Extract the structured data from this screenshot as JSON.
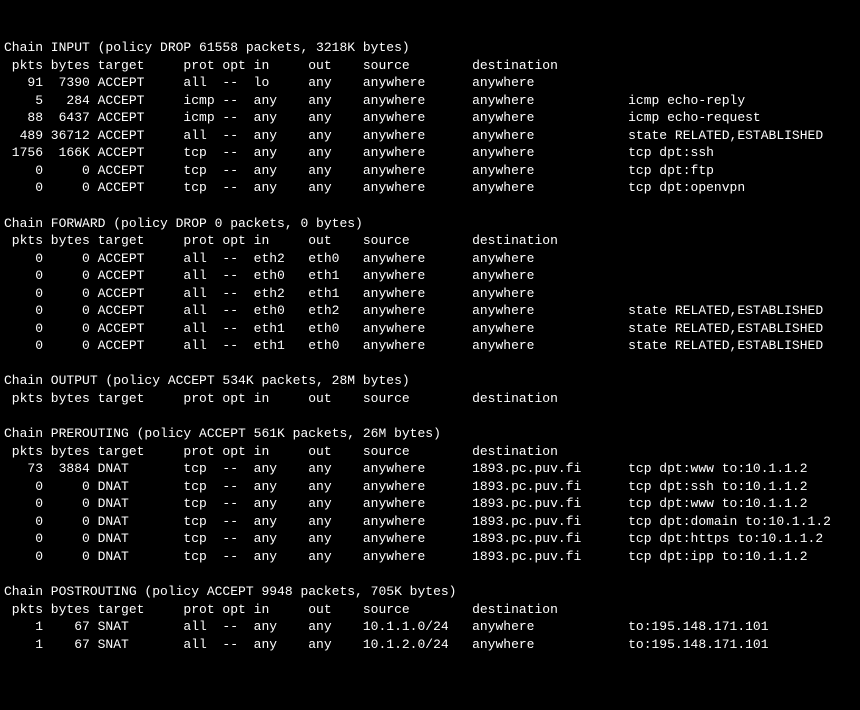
{
  "chains": [
    {
      "name": "INPUT",
      "policy": "DROP",
      "packets": "61558",
      "bytes": "3218K",
      "rows": [
        {
          "pkts": "91",
          "bytes": "7390",
          "target": "ACCEPT",
          "prot": "all",
          "opt": "--",
          "in": "lo",
          "out": "any",
          "source": "anywhere",
          "dest": "anywhere",
          "extra": ""
        },
        {
          "pkts": "5",
          "bytes": "284",
          "target": "ACCEPT",
          "prot": "icmp",
          "opt": "--",
          "in": "any",
          "out": "any",
          "source": "anywhere",
          "dest": "anywhere",
          "extra": "icmp echo-reply"
        },
        {
          "pkts": "88",
          "bytes": "6437",
          "target": "ACCEPT",
          "prot": "icmp",
          "opt": "--",
          "in": "any",
          "out": "any",
          "source": "anywhere",
          "dest": "anywhere",
          "extra": "icmp echo-request"
        },
        {
          "pkts": "489",
          "bytes": "36712",
          "target": "ACCEPT",
          "prot": "all",
          "opt": "--",
          "in": "any",
          "out": "any",
          "source": "anywhere",
          "dest": "anywhere",
          "extra": "state RELATED,ESTABLISHED"
        },
        {
          "pkts": "1756",
          "bytes": "166K",
          "target": "ACCEPT",
          "prot": "tcp",
          "opt": "--",
          "in": "any",
          "out": "any",
          "source": "anywhere",
          "dest": "anywhere",
          "extra": "tcp dpt:ssh"
        },
        {
          "pkts": "0",
          "bytes": "0",
          "target": "ACCEPT",
          "prot": "tcp",
          "opt": "--",
          "in": "any",
          "out": "any",
          "source": "anywhere",
          "dest": "anywhere",
          "extra": "tcp dpt:ftp"
        },
        {
          "pkts": "0",
          "bytes": "0",
          "target": "ACCEPT",
          "prot": "tcp",
          "opt": "--",
          "in": "any",
          "out": "any",
          "source": "anywhere",
          "dest": "anywhere",
          "extra": "tcp dpt:openvpn"
        }
      ]
    },
    {
      "name": "FORWARD",
      "policy": "DROP",
      "packets": "0",
      "bytes": "0",
      "rows": [
        {
          "pkts": "0",
          "bytes": "0",
          "target": "ACCEPT",
          "prot": "all",
          "opt": "--",
          "in": "eth2",
          "out": "eth0",
          "source": "anywhere",
          "dest": "anywhere",
          "extra": ""
        },
        {
          "pkts": "0",
          "bytes": "0",
          "target": "ACCEPT",
          "prot": "all",
          "opt": "--",
          "in": "eth0",
          "out": "eth1",
          "source": "anywhere",
          "dest": "anywhere",
          "extra": ""
        },
        {
          "pkts": "0",
          "bytes": "0",
          "target": "ACCEPT",
          "prot": "all",
          "opt": "--",
          "in": "eth2",
          "out": "eth1",
          "source": "anywhere",
          "dest": "anywhere",
          "extra": ""
        },
        {
          "pkts": "0",
          "bytes": "0",
          "target": "ACCEPT",
          "prot": "all",
          "opt": "--",
          "in": "eth0",
          "out": "eth2",
          "source": "anywhere",
          "dest": "anywhere",
          "extra": "state RELATED,ESTABLISHED"
        },
        {
          "pkts": "0",
          "bytes": "0",
          "target": "ACCEPT",
          "prot": "all",
          "opt": "--",
          "in": "eth1",
          "out": "eth0",
          "source": "anywhere",
          "dest": "anywhere",
          "extra": "state RELATED,ESTABLISHED"
        },
        {
          "pkts": "0",
          "bytes": "0",
          "target": "ACCEPT",
          "prot": "all",
          "opt": "--",
          "in": "eth1",
          "out": "eth0",
          "source": "anywhere",
          "dest": "anywhere",
          "extra": "state RELATED,ESTABLISHED"
        }
      ]
    },
    {
      "name": "OUTPUT",
      "policy": "ACCEPT",
      "packets": "534K",
      "bytes": "28M",
      "rows": []
    },
    {
      "name": "PREROUTING",
      "policy": "ACCEPT",
      "packets": "561K",
      "bytes": "26M",
      "rows": [
        {
          "pkts": "73",
          "bytes": "3884",
          "target": "DNAT",
          "prot": "tcp",
          "opt": "--",
          "in": "any",
          "out": "any",
          "source": "anywhere",
          "dest": "1893.pc.puv.fi",
          "extra": "tcp dpt:www to:10.1.1.2"
        },
        {
          "pkts": "0",
          "bytes": "0",
          "target": "DNAT",
          "prot": "tcp",
          "opt": "--",
          "in": "any",
          "out": "any",
          "source": "anywhere",
          "dest": "1893.pc.puv.fi",
          "extra": "tcp dpt:ssh to:10.1.1.2"
        },
        {
          "pkts": "0",
          "bytes": "0",
          "target": "DNAT",
          "prot": "tcp",
          "opt": "--",
          "in": "any",
          "out": "any",
          "source": "anywhere",
          "dest": "1893.pc.puv.fi",
          "extra": "tcp dpt:www to:10.1.1.2"
        },
        {
          "pkts": "0",
          "bytes": "0",
          "target": "DNAT",
          "prot": "tcp",
          "opt": "--",
          "in": "any",
          "out": "any",
          "source": "anywhere",
          "dest": "1893.pc.puv.fi",
          "extra": "tcp dpt:domain to:10.1.1.2"
        },
        {
          "pkts": "0",
          "bytes": "0",
          "target": "DNAT",
          "prot": "tcp",
          "opt": "--",
          "in": "any",
          "out": "any",
          "source": "anywhere",
          "dest": "1893.pc.puv.fi",
          "extra": "tcp dpt:https to:10.1.1.2"
        },
        {
          "pkts": "0",
          "bytes": "0",
          "target": "DNAT",
          "prot": "tcp",
          "opt": "--",
          "in": "any",
          "out": "any",
          "source": "anywhere",
          "dest": "1893.pc.puv.fi",
          "extra": "tcp dpt:ipp to:10.1.1.2"
        }
      ]
    },
    {
      "name": "POSTROUTING",
      "policy": "ACCEPT",
      "packets": "9948",
      "bytes": "705K",
      "rows": [
        {
          "pkts": "1",
          "bytes": "67",
          "target": "SNAT",
          "prot": "all",
          "opt": "--",
          "in": "any",
          "out": "any",
          "source": "10.1.1.0/24",
          "dest": "anywhere",
          "extra": "to:195.148.171.101"
        },
        {
          "pkts": "1",
          "bytes": "67",
          "target": "SNAT",
          "prot": "all",
          "opt": "--",
          "in": "any",
          "out": "any",
          "source": "10.1.2.0/24",
          "dest": "anywhere",
          "extra": "to:195.148.171.101"
        }
      ]
    }
  ],
  "headers": {
    "pkts": "pkts",
    "bytes": "bytes",
    "target": "target",
    "prot": "prot",
    "opt": "opt",
    "in": "in",
    "out": "out",
    "source": "source",
    "dest": "destination"
  }
}
